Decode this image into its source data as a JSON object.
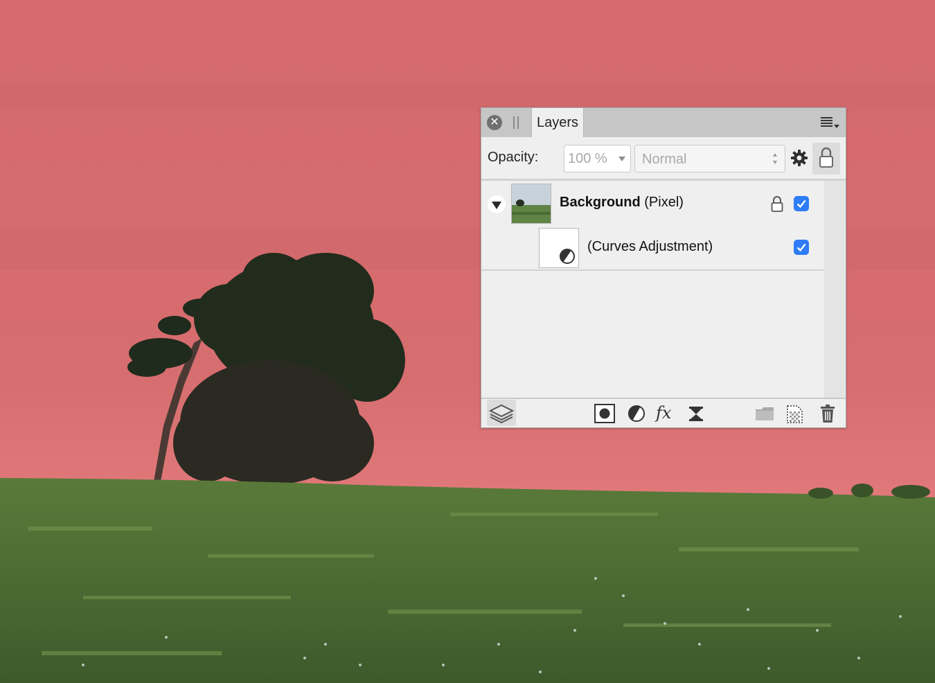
{
  "panel": {
    "tab_label": "Layers",
    "options": {
      "opacity_label": "Opacity:",
      "opacity_value": "100 %",
      "blend_mode": "Normal"
    },
    "layers": [
      {
        "name": "Background",
        "kind": "(Pixel)",
        "visible": true,
        "locked": true,
        "expanded": true
      },
      {
        "name": "(Curves Adjustment)",
        "visible": true,
        "child": true
      }
    ],
    "toolbar_icons": [
      "layers-stack-icon",
      "mask-icon",
      "adjustment-icon",
      "fx-icon",
      "live-filter-icon",
      "folder-icon",
      "new-pixel-layer-icon",
      "trash-icon"
    ]
  },
  "colors": {
    "sky_tint": "#d66d6f",
    "checkbox_accent": "#2e7cf6",
    "panel_bg": "#efefef",
    "titlebar_bg": "#c6c6c6"
  }
}
